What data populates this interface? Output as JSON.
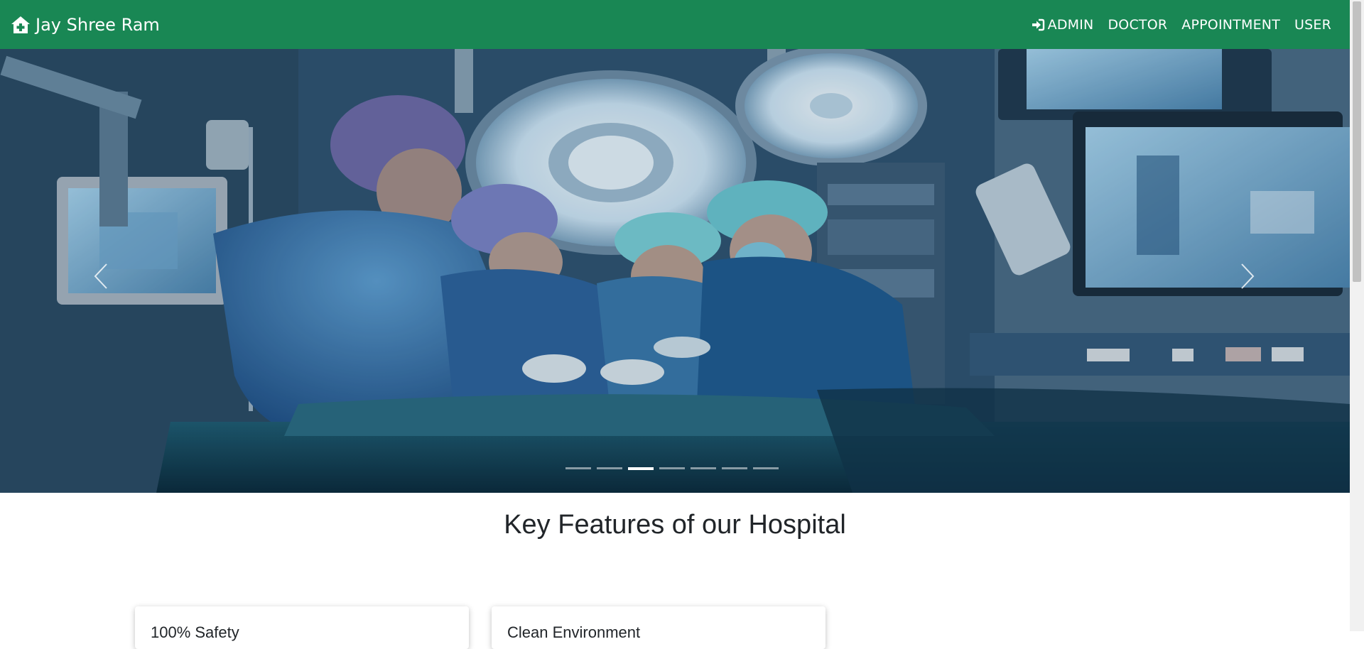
{
  "navbar": {
    "brand": "Jay Shree Ram",
    "brand_icon": "hospital-house-icon",
    "links": [
      {
        "label": "ADMIN",
        "icon": "sign-in-icon"
      },
      {
        "label": "DOCTOR"
      },
      {
        "label": "APPOINTMENT"
      },
      {
        "label": "USER"
      }
    ],
    "bg_color": "#198754"
  },
  "carousel": {
    "image_description_icon": "surgery-photo",
    "slide_count": 7,
    "active_index": 2
  },
  "features": {
    "title": "Key Features of our Hospital",
    "cards": [
      {
        "title": "100% Safety"
      },
      {
        "title": "Clean Environment"
      }
    ]
  }
}
